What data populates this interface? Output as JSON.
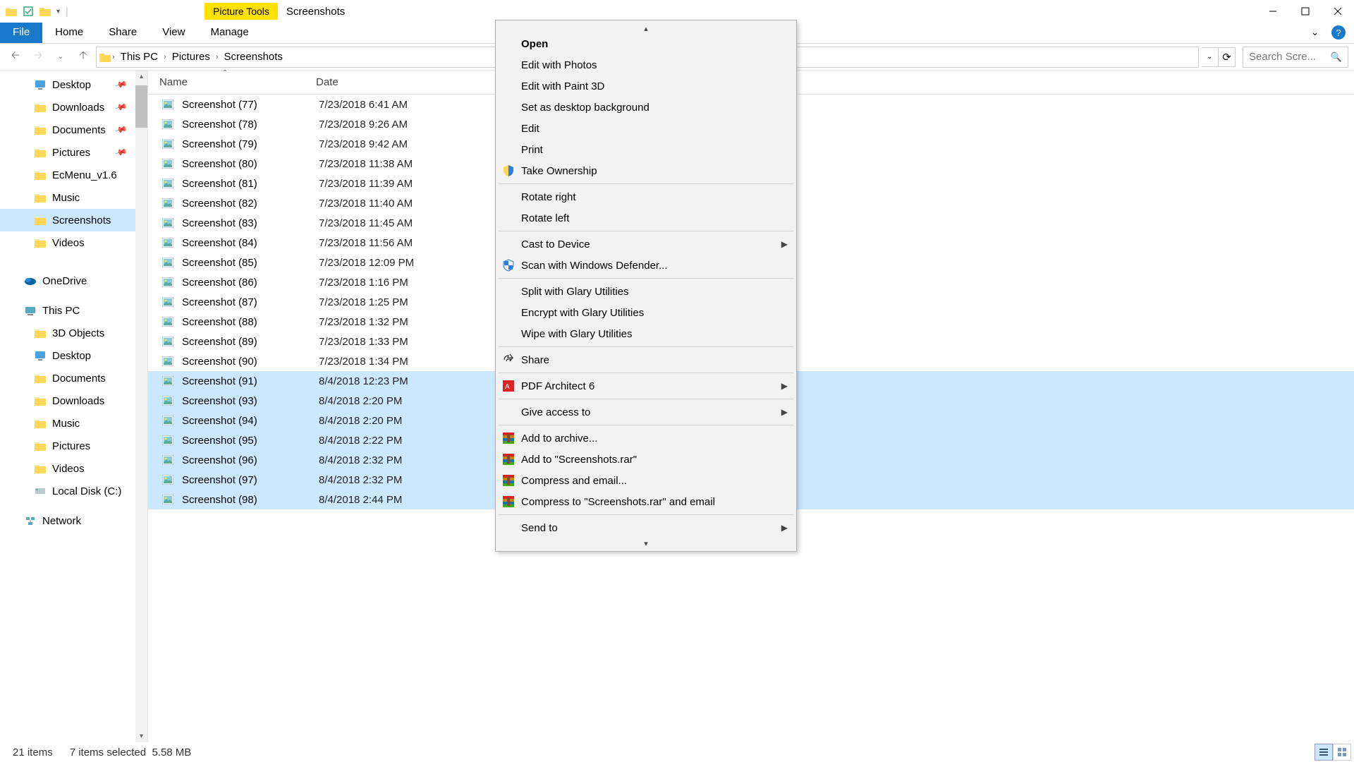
{
  "window": {
    "contextual_tab": "Picture Tools",
    "title": "Screenshots"
  },
  "ribbon": {
    "file": "File",
    "tabs": [
      "Home",
      "Share",
      "View",
      "Manage"
    ]
  },
  "breadcrumb": [
    "This PC",
    "Pictures",
    "Screenshots"
  ],
  "search_placeholder": "Search Scre...",
  "sidebar": {
    "quick": [
      {
        "label": "Desktop",
        "pinned": true,
        "icon": "desktop"
      },
      {
        "label": "Downloads",
        "pinned": true,
        "icon": "folder"
      },
      {
        "label": "Documents",
        "pinned": true,
        "icon": "folder"
      },
      {
        "label": "Pictures",
        "pinned": true,
        "icon": "folder"
      },
      {
        "label": "EcMenu_v1.6",
        "pinned": false,
        "icon": "folder"
      },
      {
        "label": "Music",
        "pinned": false,
        "icon": "folder"
      },
      {
        "label": "Screenshots",
        "pinned": false,
        "icon": "folder",
        "selected": true
      },
      {
        "label": "Videos",
        "pinned": false,
        "icon": "folder"
      }
    ],
    "groups": [
      {
        "label": "OneDrive",
        "icon": "onedrive"
      },
      {
        "label": "This PC",
        "icon": "thispc"
      },
      {
        "label": "3D Objects",
        "icon": "folder",
        "indent": true
      },
      {
        "label": "Desktop",
        "icon": "desktop",
        "indent": true
      },
      {
        "label": "Documents",
        "icon": "folder",
        "indent": true
      },
      {
        "label": "Downloads",
        "icon": "folder",
        "indent": true
      },
      {
        "label": "Music",
        "icon": "folder",
        "indent": true
      },
      {
        "label": "Pictures",
        "icon": "folder",
        "indent": true
      },
      {
        "label": "Videos",
        "icon": "folder",
        "indent": true
      },
      {
        "label": "Local Disk (C:)",
        "icon": "disk",
        "indent": true
      },
      {
        "label": "Network",
        "icon": "network"
      }
    ]
  },
  "columns": {
    "name": "Name",
    "date": "Date"
  },
  "files": [
    {
      "name": "Screenshot (77)",
      "date": "7/23/2018 6:41 AM",
      "sel": false
    },
    {
      "name": "Screenshot (78)",
      "date": "7/23/2018 9:26 AM",
      "sel": false
    },
    {
      "name": "Screenshot (79)",
      "date": "7/23/2018 9:42 AM",
      "sel": false
    },
    {
      "name": "Screenshot (80)",
      "date": "7/23/2018 11:38 AM",
      "sel": false
    },
    {
      "name": "Screenshot (81)",
      "date": "7/23/2018 11:39 AM",
      "sel": false
    },
    {
      "name": "Screenshot (82)",
      "date": "7/23/2018 11:40 AM",
      "sel": false
    },
    {
      "name": "Screenshot (83)",
      "date": "7/23/2018 11:45 AM",
      "sel": false
    },
    {
      "name": "Screenshot (84)",
      "date": "7/23/2018 11:56 AM",
      "sel": false
    },
    {
      "name": "Screenshot (85)",
      "date": "7/23/2018 12:09 PM",
      "sel": false
    },
    {
      "name": "Screenshot (86)",
      "date": "7/23/2018 1:16 PM",
      "sel": false
    },
    {
      "name": "Screenshot (87)",
      "date": "7/23/2018 1:25 PM",
      "sel": false
    },
    {
      "name": "Screenshot (88)",
      "date": "7/23/2018 1:32 PM",
      "sel": false
    },
    {
      "name": "Screenshot (89)",
      "date": "7/23/2018 1:33 PM",
      "sel": false
    },
    {
      "name": "Screenshot (90)",
      "date": "7/23/2018 1:34 PM",
      "sel": false
    },
    {
      "name": "Screenshot (91)",
      "date": "8/4/2018 12:23 PM",
      "sel": true
    },
    {
      "name": "Screenshot (93)",
      "date": "8/4/2018 2:20 PM",
      "sel": true
    },
    {
      "name": "Screenshot (94)",
      "date": "8/4/2018 2:20 PM",
      "sel": true
    },
    {
      "name": "Screenshot (95)",
      "date": "8/4/2018 2:22 PM",
      "sel": true
    },
    {
      "name": "Screenshot (96)",
      "date": "8/4/2018 2:32 PM",
      "sel": true
    },
    {
      "name": "Screenshot (97)",
      "date": "8/4/2018 2:32 PM",
      "sel": true
    },
    {
      "name": "Screenshot (98)",
      "date": "8/4/2018 2:44 PM",
      "sel": true
    }
  ],
  "status": {
    "items": "21 items",
    "selected": "7 items selected",
    "size": "5.58 MB"
  },
  "context_menu": [
    {
      "label": "Open",
      "bold": true
    },
    {
      "label": "Edit with Photos"
    },
    {
      "label": "Edit with Paint 3D"
    },
    {
      "label": "Set as desktop background"
    },
    {
      "label": "Edit"
    },
    {
      "label": "Print"
    },
    {
      "label": "Take Ownership",
      "icon": "shield"
    },
    {
      "sep": true
    },
    {
      "label": "Rotate right"
    },
    {
      "label": "Rotate left"
    },
    {
      "sep": true
    },
    {
      "label": "Cast to Device",
      "submenu": true
    },
    {
      "label": "Scan with Windows Defender...",
      "icon": "defender"
    },
    {
      "sep": true
    },
    {
      "label": "Split with Glary Utilities"
    },
    {
      "label": "Encrypt with Glary Utilities"
    },
    {
      "label": "Wipe with Glary Utilities"
    },
    {
      "sep": true
    },
    {
      "label": "Share",
      "icon": "share"
    },
    {
      "sep": true
    },
    {
      "label": "PDF Architect 6",
      "icon": "pdf",
      "submenu": true
    },
    {
      "sep": true
    },
    {
      "label": "Give access to",
      "submenu": true
    },
    {
      "sep": true
    },
    {
      "label": "Add to archive...",
      "icon": "rar"
    },
    {
      "label": "Add to \"Screenshots.rar\"",
      "icon": "rar"
    },
    {
      "label": "Compress and email...",
      "icon": "rar"
    },
    {
      "label": "Compress to \"Screenshots.rar\" and email",
      "icon": "rar"
    },
    {
      "sep": true
    },
    {
      "label": "Send to",
      "submenu": true
    }
  ]
}
